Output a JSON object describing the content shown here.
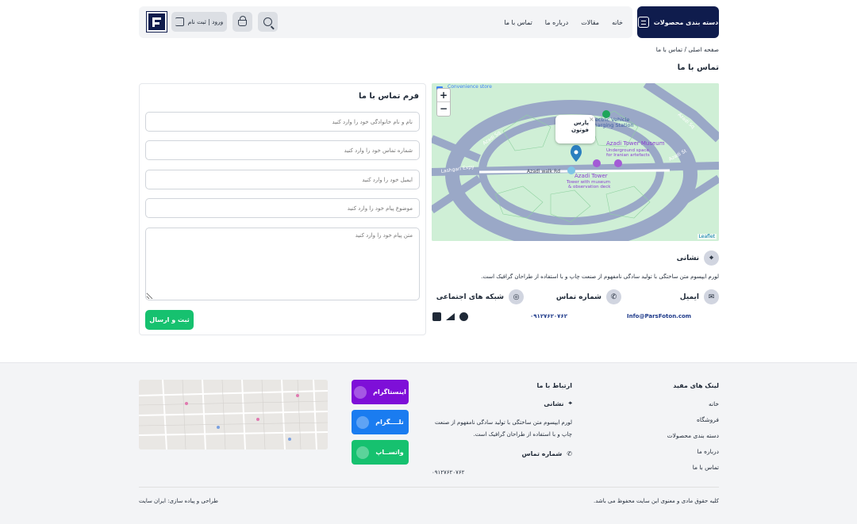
{
  "header": {
    "category_button": "دسته بندی محصولات",
    "nav": [
      "خانه",
      "مقالات",
      "درباره ما",
      "تماس با ما"
    ],
    "login": "ورود | ثبت نام"
  },
  "breadcrumb": "صفحه اصلی / تماس با ما",
  "page_title": "تماس با ما",
  "map": {
    "popup": "پارس فوتون",
    "attribution": "Leaflet",
    "zoom_in": "+",
    "zoom_out": "−",
    "labels": {
      "museum": "Azadi Tower Museum",
      "tower": "Azadi Tower",
      "station": "Electric Vehicle Charging Station",
      "store": "Convenience store",
      "road": "Azadi walk Rd",
      "lashgari": "Lashgari Expy",
      "sq": "Azadi Sq",
      "st": "Azadi St"
    }
  },
  "address": {
    "title": "نشانی",
    "text": "لورم ایپسوم متن ساختگی با تولید سادگی نامفهوم از صنعت چاپ و با استفاده از طراحان گرافیک است."
  },
  "contact": {
    "email_label": "ایمیل",
    "email_value": "Info@ParsFoton.com",
    "phone_label": "شماره تماس",
    "phone_value": "۰۹۱۲۷۶۲۰۷۶۲",
    "social_label": "شبکه های اجتماعی"
  },
  "form": {
    "title": "فرم تماس با ما",
    "name_placeholder": "نام و نام خانوادگی خود را وارد کنید",
    "phone_placeholder": "شماره تماس خود را وارد کنید",
    "email_placeholder": "ایمیل خود را وارد کنید",
    "subject_placeholder": "موضوع پیام خود را وارد کنید",
    "message_placeholder": "متن پیام خود را وارد کنید",
    "submit": "ثبت و ارسال"
  },
  "footer": {
    "links_title": "لینک های مفید",
    "links": [
      "خانه",
      "فروشگاه",
      "دسته بندی محصولات",
      "درباره ما",
      "تماس با ما"
    ],
    "contact_title": "ارتباط با ما",
    "address_title": "نشانی",
    "address_text": "لورم ایپسوم متن ساختگی با تولید سادگی نامفهوم از صنعت چاپ و با استفاده از طراحان گرافیک است.",
    "phone_title": "شماره تماس",
    "phone_value": "۰۹۱۲۷۶۲۰۷۶۲",
    "instagram": "اینستاگرام",
    "telegram": "تلــــگرام",
    "whatsapp": "واتســاپ",
    "copyright": "کلیه حقوق مادی و معنوی این سایت محفوظ می باشد.",
    "designer": "طراحی و پیاده سازی: ایران سایت",
    "colors": {
      "instagram": "#7e0fd8",
      "telegram": "#1a7cf0",
      "whatsapp": "#16c16f"
    }
  }
}
